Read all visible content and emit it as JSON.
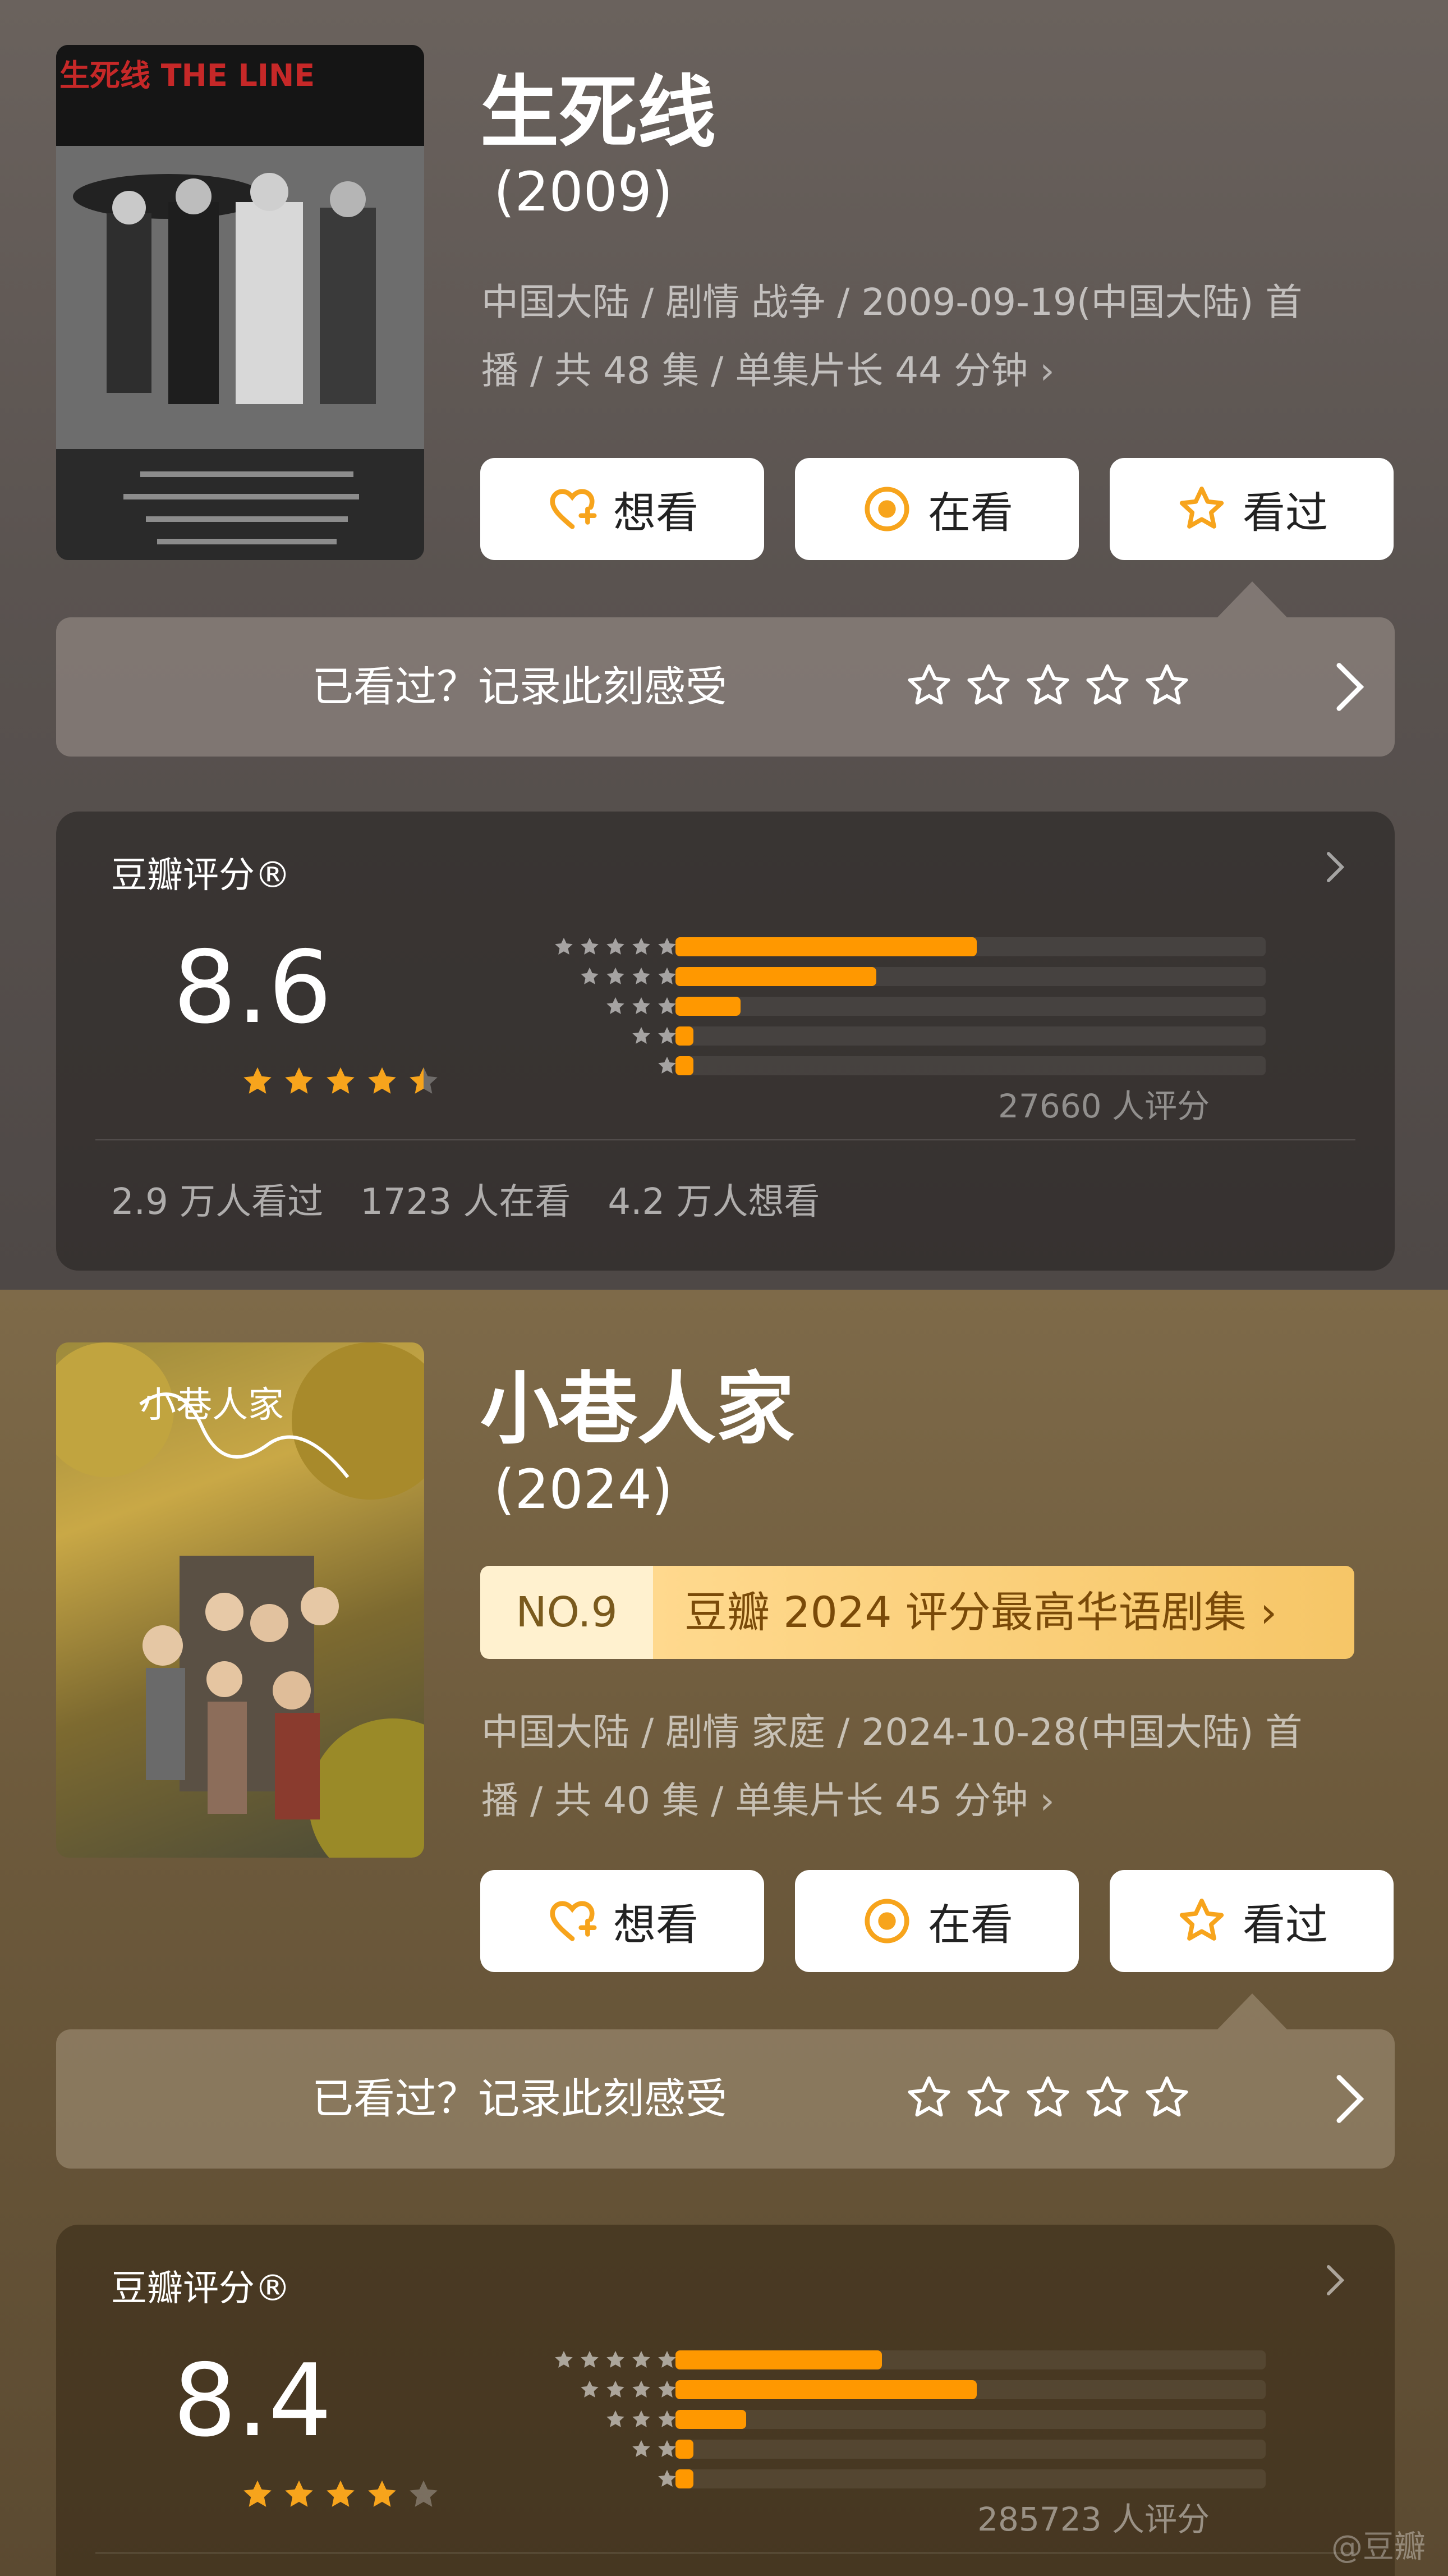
{
  "shows": [
    {
      "poster_label": "生死线 THE LINE",
      "title": "生死线",
      "year": "(2009)",
      "meta_line1": "中国大陆 / 剧情 战争 / 2009-09-19(中国大陆) 首",
      "meta_line2": "播 / 共 48 集 / 单集片长 44 分钟",
      "chevron": "›",
      "buttons": {
        "want": "想看",
        "watching": "在看",
        "watched": "看过"
      },
      "record_prompt": "已看过？记录此刻感受",
      "rating_title": "豆瓣评分®",
      "score": "8.6",
      "score_stars": 4.5,
      "distribution_pct": {
        "five": 51,
        "four": 34,
        "three": 11,
        "two": 3,
        "one": 3
      },
      "rating_count": "27660 人评分",
      "stats": {
        "watched": "2.9 万人看过",
        "watching": "1723 人在看",
        "want": "4.2 万人想看"
      }
    },
    {
      "poster_label": "小巷人家",
      "title": "小巷人家",
      "year": "(2024)",
      "badge_no": "NO.9",
      "badge_text": "豆瓣 2024 评分最高华语剧集 ›",
      "meta_line1": "中国大陆 / 剧情 家庭 / 2024-10-28(中国大陆) 首",
      "meta_line2": "播 / 共 40 集 / 单集片长 45 分钟",
      "chevron": "›",
      "buttons": {
        "want": "想看",
        "watching": "在看",
        "watched": "看过"
      },
      "record_prompt": "已看过？记录此刻感受",
      "rating_title": "豆瓣评分®",
      "score": "8.4",
      "score_stars": 4.0,
      "distribution_pct": {
        "five": 35,
        "four": 51,
        "three": 12,
        "two": 3,
        "one": 3
      },
      "rating_count": "285723 人评分"
    }
  ],
  "watermark": "@豆瓣",
  "colors": {
    "accent": "#ff9800",
    "star_gold": "#f7a41c",
    "badge_bg": "#f6c667"
  }
}
